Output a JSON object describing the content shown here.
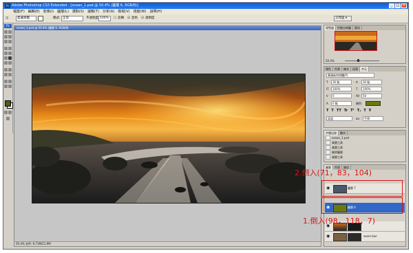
{
  "window": {
    "title": "Adobe Photoshop CS3 Extended - [ocean_1.psd @ 50.4% (圖層 6, RGB/8)]",
    "logo": "Ps",
    "controls": [
      "_",
      "□",
      "×"
    ]
  },
  "menu": [
    "檔案(F)",
    "編輯(E)",
    "影像(I)",
    "圖層(L)",
    "選取(S)",
    "濾鏡(T)",
    "分析(A)",
    "檢視(V)",
    "視窗(W)",
    "說明(H)"
  ],
  "options": {
    "preset": "柔邊漸層",
    "mode_label": "模式:",
    "mode_value": "正常",
    "opacity_label": "不透明度:",
    "opacity_value": "100%",
    "reverse_label": "反轉",
    "dither_label": "混色",
    "transparency_label": "透明度",
    "workspace": "工作區 ▾"
  },
  "toolbox": {
    "header": "Ps"
  },
  "colors": {
    "foreground": "#4e5e10",
    "background": "#ffffff",
    "annotation": "#e01010",
    "selected": "#3168c8"
  },
  "document": {
    "title": "ocean_1.psd @ 50.4% (圖層 6, RGB/8)",
    "status": "50.4%     文件: 6.71M/21.9M"
  },
  "navigator": {
    "tabs": [
      "導覽器",
      "色階分佈圖",
      "資訊"
    ],
    "zoom": "50.4%"
  },
  "character": {
    "tabs": [
      "顏色",
      "色票",
      "樣式",
      "段落",
      "字元"
    ],
    "font": "華康新特明體(P)",
    "size1": "36 點",
    "size2": "30 點",
    "scale1": "100%",
    "scale2": "100%",
    "tracking": "0",
    "kerning": "50",
    "baseline": "0 點",
    "color_label": "顏色:",
    "lang": "英語",
    "aa": "平滑"
  },
  "history": {
    "tabs": [
      "步驟記錄",
      "動作"
    ],
    "items": [
      "ocean_1.psd",
      "漸層工具",
      "漸層工具",
      "刪除圖層",
      "漸層工具"
    ]
  },
  "layers": {
    "tabs": [
      "圖層",
      "色版",
      "路徑"
    ],
    "rows": [
      {
        "name": "圖層 7",
        "color": "#4a5868",
        "selected": false
      },
      {
        "name": "圖層 6",
        "color": "#6a7a10",
        "selected": true
      },
      {
        "name": "",
        "color": "#7a6040",
        "selected": false
      },
      {
        "name": "",
        "color": "#2b2b2b",
        "selected": false
      },
      {
        "name": "zoom blur",
        "color": "#6a6a6a",
        "selected": false
      }
    ]
  },
  "annotations": {
    "label_top": "2.倒入(71，83，104)",
    "label_bottom": "1.倒入(98，118，7)"
  }
}
